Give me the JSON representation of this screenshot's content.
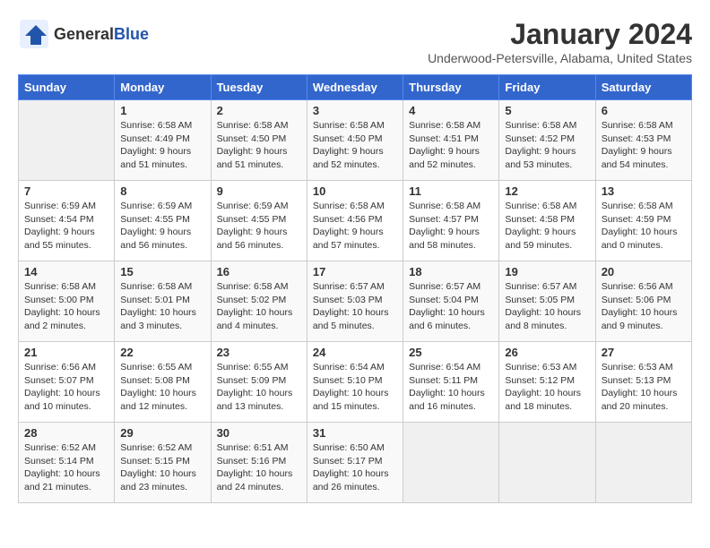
{
  "logo": {
    "general": "General",
    "blue": "Blue"
  },
  "title": "January 2024",
  "location": "Underwood-Petersville, Alabama, United States",
  "weekdays": [
    "Sunday",
    "Monday",
    "Tuesday",
    "Wednesday",
    "Thursday",
    "Friday",
    "Saturday"
  ],
  "weeks": [
    [
      {
        "day": "",
        "info": ""
      },
      {
        "day": "1",
        "info": "Sunrise: 6:58 AM\nSunset: 4:49 PM\nDaylight: 9 hours\nand 51 minutes."
      },
      {
        "day": "2",
        "info": "Sunrise: 6:58 AM\nSunset: 4:50 PM\nDaylight: 9 hours\nand 51 minutes."
      },
      {
        "day": "3",
        "info": "Sunrise: 6:58 AM\nSunset: 4:50 PM\nDaylight: 9 hours\nand 52 minutes."
      },
      {
        "day": "4",
        "info": "Sunrise: 6:58 AM\nSunset: 4:51 PM\nDaylight: 9 hours\nand 52 minutes."
      },
      {
        "day": "5",
        "info": "Sunrise: 6:58 AM\nSunset: 4:52 PM\nDaylight: 9 hours\nand 53 minutes."
      },
      {
        "day": "6",
        "info": "Sunrise: 6:58 AM\nSunset: 4:53 PM\nDaylight: 9 hours\nand 54 minutes."
      }
    ],
    [
      {
        "day": "7",
        "info": "Sunrise: 6:59 AM\nSunset: 4:54 PM\nDaylight: 9 hours\nand 55 minutes."
      },
      {
        "day": "8",
        "info": "Sunrise: 6:59 AM\nSunset: 4:55 PM\nDaylight: 9 hours\nand 56 minutes."
      },
      {
        "day": "9",
        "info": "Sunrise: 6:59 AM\nSunset: 4:55 PM\nDaylight: 9 hours\nand 56 minutes."
      },
      {
        "day": "10",
        "info": "Sunrise: 6:58 AM\nSunset: 4:56 PM\nDaylight: 9 hours\nand 57 minutes."
      },
      {
        "day": "11",
        "info": "Sunrise: 6:58 AM\nSunset: 4:57 PM\nDaylight: 9 hours\nand 58 minutes."
      },
      {
        "day": "12",
        "info": "Sunrise: 6:58 AM\nSunset: 4:58 PM\nDaylight: 9 hours\nand 59 minutes."
      },
      {
        "day": "13",
        "info": "Sunrise: 6:58 AM\nSunset: 4:59 PM\nDaylight: 10 hours\nand 0 minutes."
      }
    ],
    [
      {
        "day": "14",
        "info": "Sunrise: 6:58 AM\nSunset: 5:00 PM\nDaylight: 10 hours\nand 2 minutes."
      },
      {
        "day": "15",
        "info": "Sunrise: 6:58 AM\nSunset: 5:01 PM\nDaylight: 10 hours\nand 3 minutes."
      },
      {
        "day": "16",
        "info": "Sunrise: 6:58 AM\nSunset: 5:02 PM\nDaylight: 10 hours\nand 4 minutes."
      },
      {
        "day": "17",
        "info": "Sunrise: 6:57 AM\nSunset: 5:03 PM\nDaylight: 10 hours\nand 5 minutes."
      },
      {
        "day": "18",
        "info": "Sunrise: 6:57 AM\nSunset: 5:04 PM\nDaylight: 10 hours\nand 6 minutes."
      },
      {
        "day": "19",
        "info": "Sunrise: 6:57 AM\nSunset: 5:05 PM\nDaylight: 10 hours\nand 8 minutes."
      },
      {
        "day": "20",
        "info": "Sunrise: 6:56 AM\nSunset: 5:06 PM\nDaylight: 10 hours\nand 9 minutes."
      }
    ],
    [
      {
        "day": "21",
        "info": "Sunrise: 6:56 AM\nSunset: 5:07 PM\nDaylight: 10 hours\nand 10 minutes."
      },
      {
        "day": "22",
        "info": "Sunrise: 6:55 AM\nSunset: 5:08 PM\nDaylight: 10 hours\nand 12 minutes."
      },
      {
        "day": "23",
        "info": "Sunrise: 6:55 AM\nSunset: 5:09 PM\nDaylight: 10 hours\nand 13 minutes."
      },
      {
        "day": "24",
        "info": "Sunrise: 6:54 AM\nSunset: 5:10 PM\nDaylight: 10 hours\nand 15 minutes."
      },
      {
        "day": "25",
        "info": "Sunrise: 6:54 AM\nSunset: 5:11 PM\nDaylight: 10 hours\nand 16 minutes."
      },
      {
        "day": "26",
        "info": "Sunrise: 6:53 AM\nSunset: 5:12 PM\nDaylight: 10 hours\nand 18 minutes."
      },
      {
        "day": "27",
        "info": "Sunrise: 6:53 AM\nSunset: 5:13 PM\nDaylight: 10 hours\nand 20 minutes."
      }
    ],
    [
      {
        "day": "28",
        "info": "Sunrise: 6:52 AM\nSunset: 5:14 PM\nDaylight: 10 hours\nand 21 minutes."
      },
      {
        "day": "29",
        "info": "Sunrise: 6:52 AM\nSunset: 5:15 PM\nDaylight: 10 hours\nand 23 minutes."
      },
      {
        "day": "30",
        "info": "Sunrise: 6:51 AM\nSunset: 5:16 PM\nDaylight: 10 hours\nand 24 minutes."
      },
      {
        "day": "31",
        "info": "Sunrise: 6:50 AM\nSunset: 5:17 PM\nDaylight: 10 hours\nand 26 minutes."
      },
      {
        "day": "",
        "info": ""
      },
      {
        "day": "",
        "info": ""
      },
      {
        "day": "",
        "info": ""
      }
    ]
  ]
}
